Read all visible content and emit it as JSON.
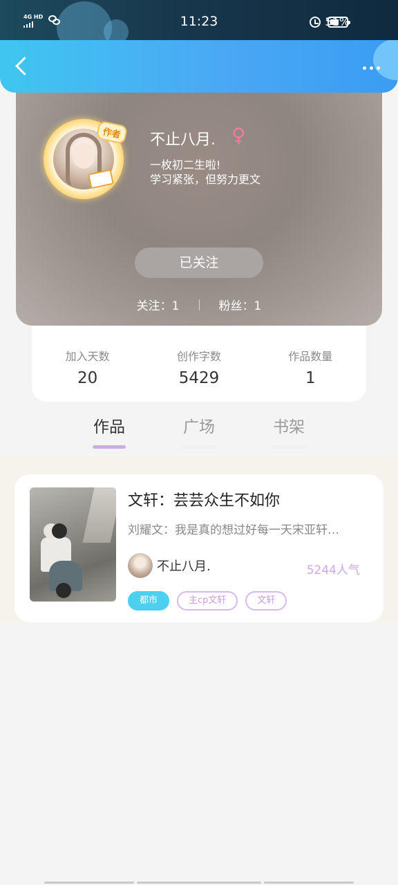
{
  "status_bar": {
    "network": "4G HD",
    "time": "11:23",
    "battery_percent": "51%",
    "battery_level": 0.51
  },
  "nav": {
    "back_icon": "chevron-left-icon",
    "more_icon": "more-dots-icon"
  },
  "profile": {
    "author_badge": "作者",
    "username": "不止八月.",
    "gender_symbol": "♀",
    "bio_line1": "一枚初二生啦!",
    "bio_line2": "学习紧张，但努力更文",
    "follow_button": "已关注",
    "following": "关注：1",
    "followers": "粉丝：1"
  },
  "stats": [
    {
      "label": "加入天数",
      "value": "20"
    },
    {
      "label": "创作字数",
      "value": "5429"
    },
    {
      "label": "作品数量",
      "value": "1"
    }
  ],
  "tabs": [
    {
      "label": "作品",
      "active": true
    },
    {
      "label": "广场",
      "active": false
    },
    {
      "label": "书架",
      "active": false
    }
  ],
  "works": [
    {
      "title": "文轩：芸芸众生不如你",
      "description": "刘耀文：我是真的想过好每一天宋亚轩…",
      "author": "不止八月.",
      "popularity": "5244人气",
      "tags": [
        "都市",
        "主cp文轩",
        "文轩"
      ]
    }
  ],
  "colors": {
    "nav_gradient_start": "#3fc6f0",
    "nav_gradient_end": "#3a9df2",
    "active_tab_underline": "#c9aee6",
    "tag_primary": "#4dd0ef",
    "tag_outline": "#d9b8ec",
    "gender_female": "#f07b9b"
  }
}
